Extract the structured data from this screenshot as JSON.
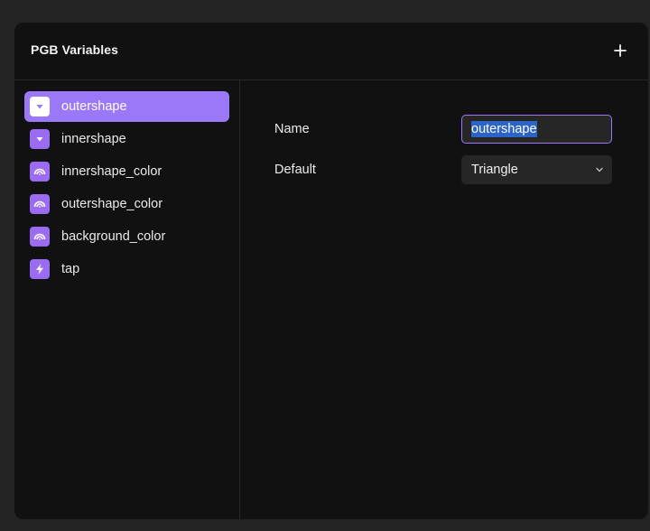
{
  "panel": {
    "title": "PGB Variables",
    "add_icon": "plus-icon"
  },
  "sidebar": {
    "items": [
      {
        "label": "outershape",
        "icon": "dropdown-triangle-icon",
        "selected": true
      },
      {
        "label": "innershape",
        "icon": "dropdown-triangle-icon",
        "selected": false
      },
      {
        "label": "innershape_color",
        "icon": "rainbow-color-icon",
        "selected": false
      },
      {
        "label": "outershape_color",
        "icon": "rainbow-color-icon",
        "selected": false
      },
      {
        "label": "background_color",
        "icon": "rainbow-color-icon",
        "selected": false
      },
      {
        "label": "tap",
        "icon": "lightning-bolt-icon",
        "selected": false
      }
    ]
  },
  "form": {
    "name_label": "Name",
    "name_value": "outershape",
    "default_label": "Default",
    "default_value": "Triangle"
  },
  "colors": {
    "accent": "#9b78f7",
    "icon_bg": "#9b6bf2",
    "panel_bg": "#111111",
    "page_bg": "#232323",
    "selection": "#2b64c6"
  }
}
